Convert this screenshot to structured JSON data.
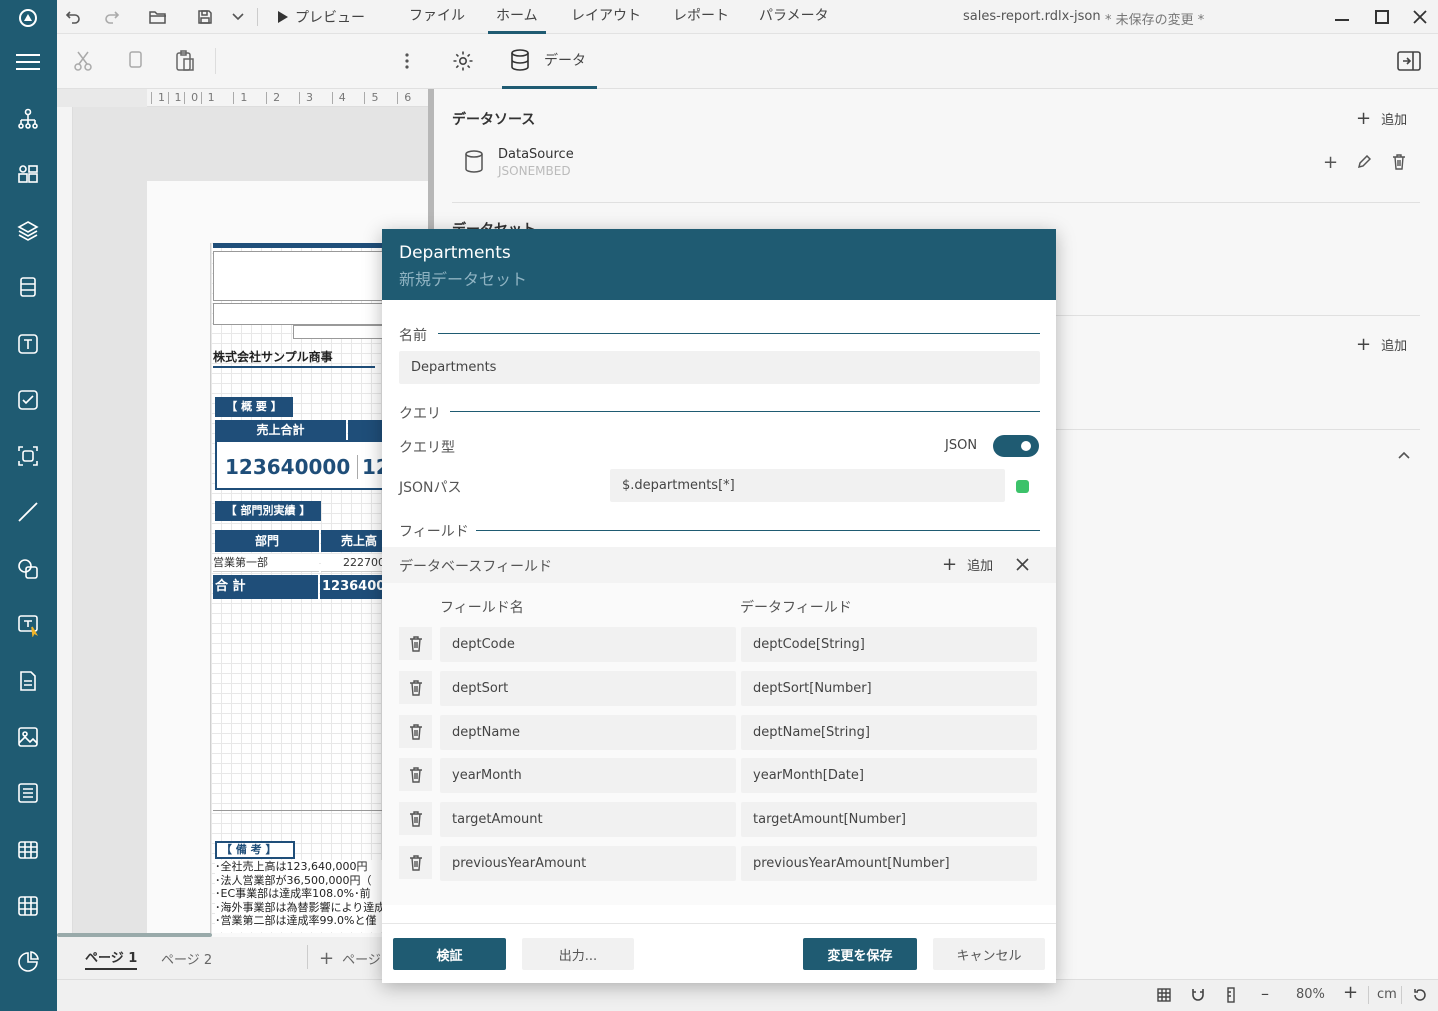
{
  "titlebar": {
    "menu": [
      "ファイル",
      "ホーム",
      "レイアウト",
      "レポート",
      "パラメータ"
    ],
    "preview_label": "プレビュー",
    "file_name": "sales-report.rdlx-json",
    "unsaved": "* 未保存の変更 *"
  },
  "toolbar": {
    "data_tab": "データ"
  },
  "ruler": {
    "h_ticks": [
      "1",
      "1",
      "0",
      "1",
      "1",
      "2",
      "3",
      "4",
      "5",
      "6"
    ]
  },
  "report": {
    "company": "株式会社サンプル商事",
    "overview": "【 概 要 】",
    "sales_total_label": "売上合計",
    "sales_total_value": "123640000",
    "sales_total_value2": "12",
    "dept_section": "【 部門別実績 】",
    "col_dept": "部門",
    "col_sales": "売上高",
    "row1_dept": "営業第一部",
    "row1_val": "222700",
    "total_label": "合 計",
    "total_val": "1236400",
    "notes_title": "【 備 考 】",
    "notes": [
      "･全社売上高は123,640,000円",
      "･法人営業部が36,500,000円（",
      "･EC事業部は達成率108.0%･前",
      "･海外事業部は為替影響により達成",
      "･営業第二部は達成率99.0%と僅"
    ]
  },
  "page_tabs": {
    "page1": "ページ 1",
    "page2": "ページ 2",
    "add": "ページ"
  },
  "right_panel": {
    "datasource_title": "データソース",
    "add_label": "追加",
    "datasource_name": "DataSource",
    "datasource_type": "JSONEMBED",
    "dataset_title_partial": "データセット",
    "add_label2": "追加"
  },
  "dialog": {
    "title": "Departments",
    "subtitle": "新規データセット",
    "name_label": "名前",
    "name_value": "Departments",
    "query_section": "クエリ",
    "query_type_label": "クエリ型",
    "query_type_value": "JSON",
    "query_type_on": true,
    "json_path_label": "JSONパス",
    "json_path_value": "$.departments[*]",
    "fields_section": "フィールド",
    "db_fields_label": "データベースフィールド",
    "add_label": "追加",
    "col_field_name": "フィールド名",
    "col_data_field": "データフィールド",
    "fields": [
      {
        "name": "deptCode",
        "data": "deptCode[String]"
      },
      {
        "name": "deptSort",
        "data": "deptSort[Number]"
      },
      {
        "name": "deptName",
        "data": "deptName[String]"
      },
      {
        "name": "yearMonth",
        "data": "yearMonth[Date]"
      },
      {
        "name": "targetAmount",
        "data": "targetAmount[Number]"
      },
      {
        "name": "previousYearAmount",
        "data": "previousYearAmount[Number]"
      }
    ],
    "btn_validate": "検証",
    "btn_export": "出力...",
    "btn_save": "変更を保存",
    "btn_cancel": "キャンセル"
  },
  "status": {
    "zoom": "80%",
    "unit": "cm"
  },
  "colors": {
    "accent": "#1f5b72",
    "report_navy": "#1f4e79",
    "ok": "#3cc26a"
  }
}
